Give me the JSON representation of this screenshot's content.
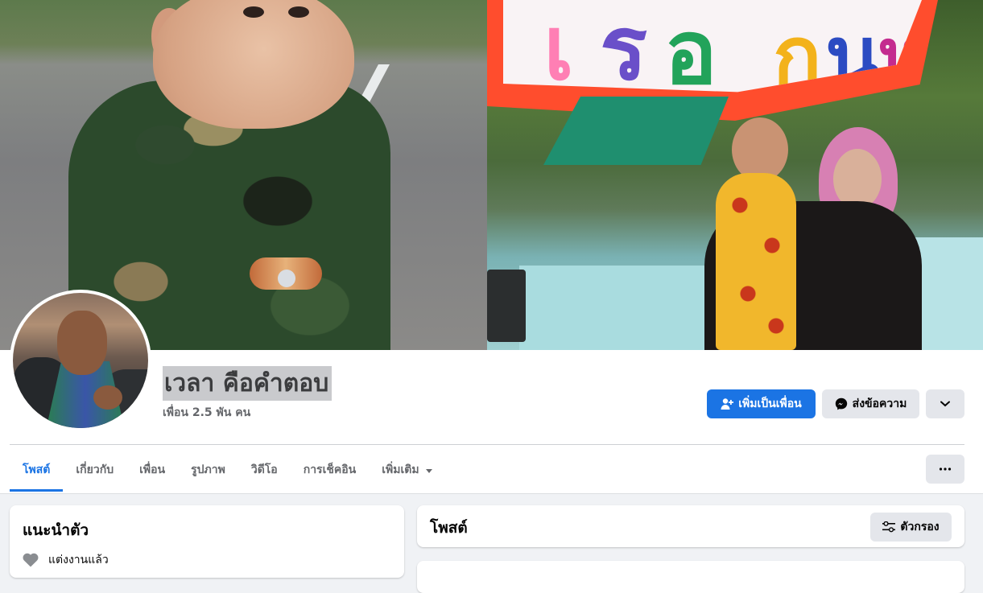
{
  "profile": {
    "name": "เวลา คือคำตอบ",
    "friends_count": "เพื่อน 2.5 พัน คน"
  },
  "actions": {
    "add_friend": "เพิ่มเป็นเพื่อน",
    "message": "ส่งข้อความ"
  },
  "tabs": [
    "โพสต์",
    "เกี่ยวกับ",
    "เพื่อน",
    "รูปภาพ",
    "วิดีโอ",
    "การเช็คอิน",
    "เพิ่มเติม"
  ],
  "intro": {
    "title": "แนะนำตัว",
    "relationship": "แต่งงานแล้ว"
  },
  "posts": {
    "title": "โพสต์",
    "filter_label": "ตัวกรอง"
  },
  "cover_sign_text": "เรือกินหอย",
  "colors": {
    "accent": "#1b74e4",
    "page_bg": "#f0f2f5",
    "button_grey": "#e4e6eb"
  }
}
